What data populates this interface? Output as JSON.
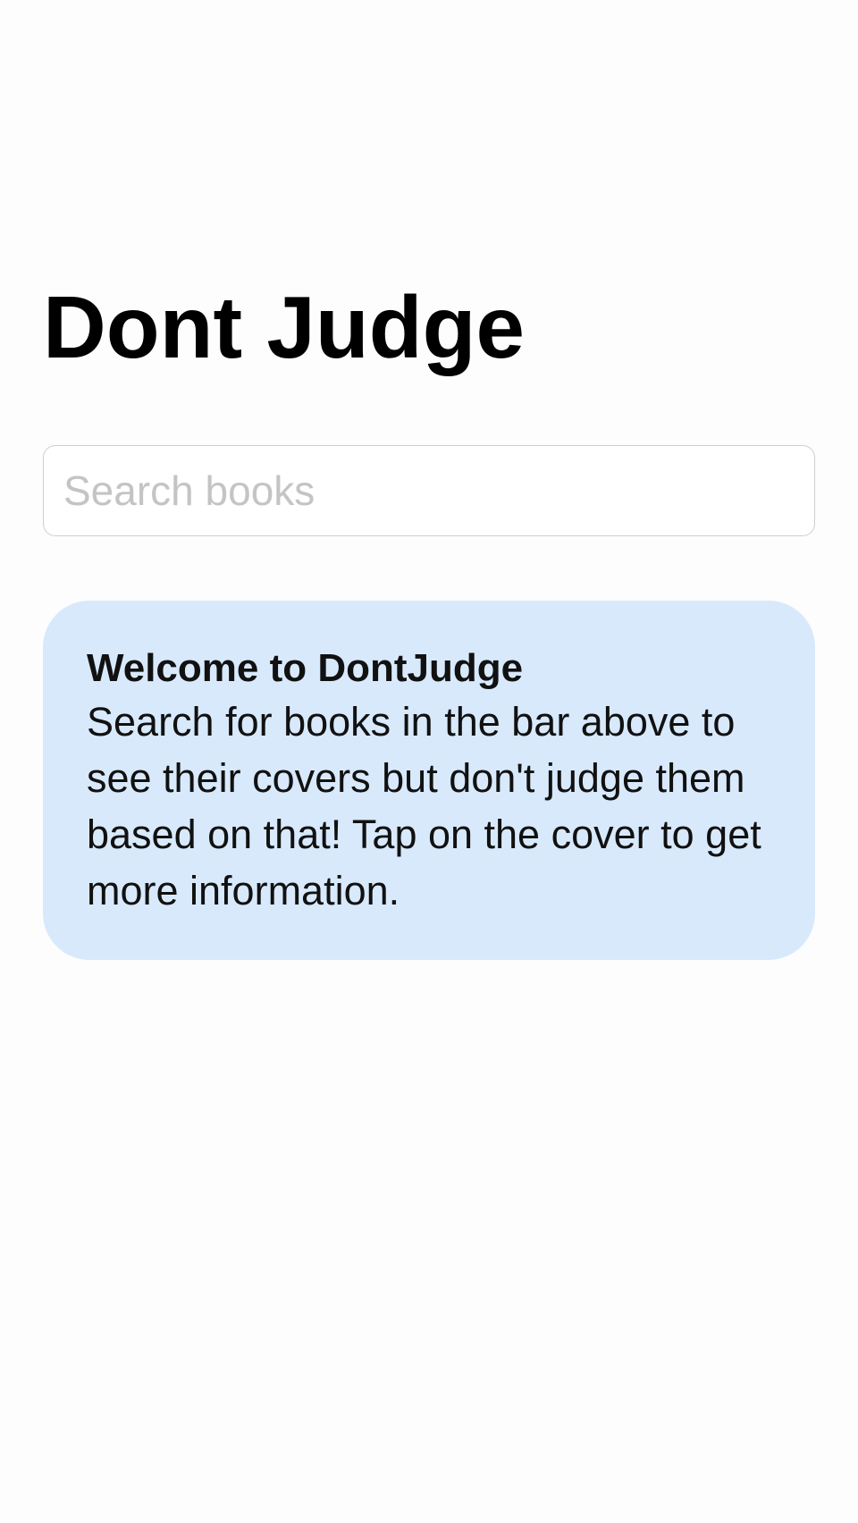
{
  "header": {
    "title": "Dont Judge"
  },
  "search": {
    "placeholder": "Search books",
    "value": ""
  },
  "welcome": {
    "title": "Welcome to DontJudge",
    "body": "Search for books in the bar above to see their covers but don't judge them based on that! Tap on the cover to get more information."
  },
  "colors": {
    "background": "#fdfdfd",
    "card_background": "#d8e9fc",
    "placeholder_text": "#c4c4c4",
    "input_border": "#cfcfcf"
  }
}
